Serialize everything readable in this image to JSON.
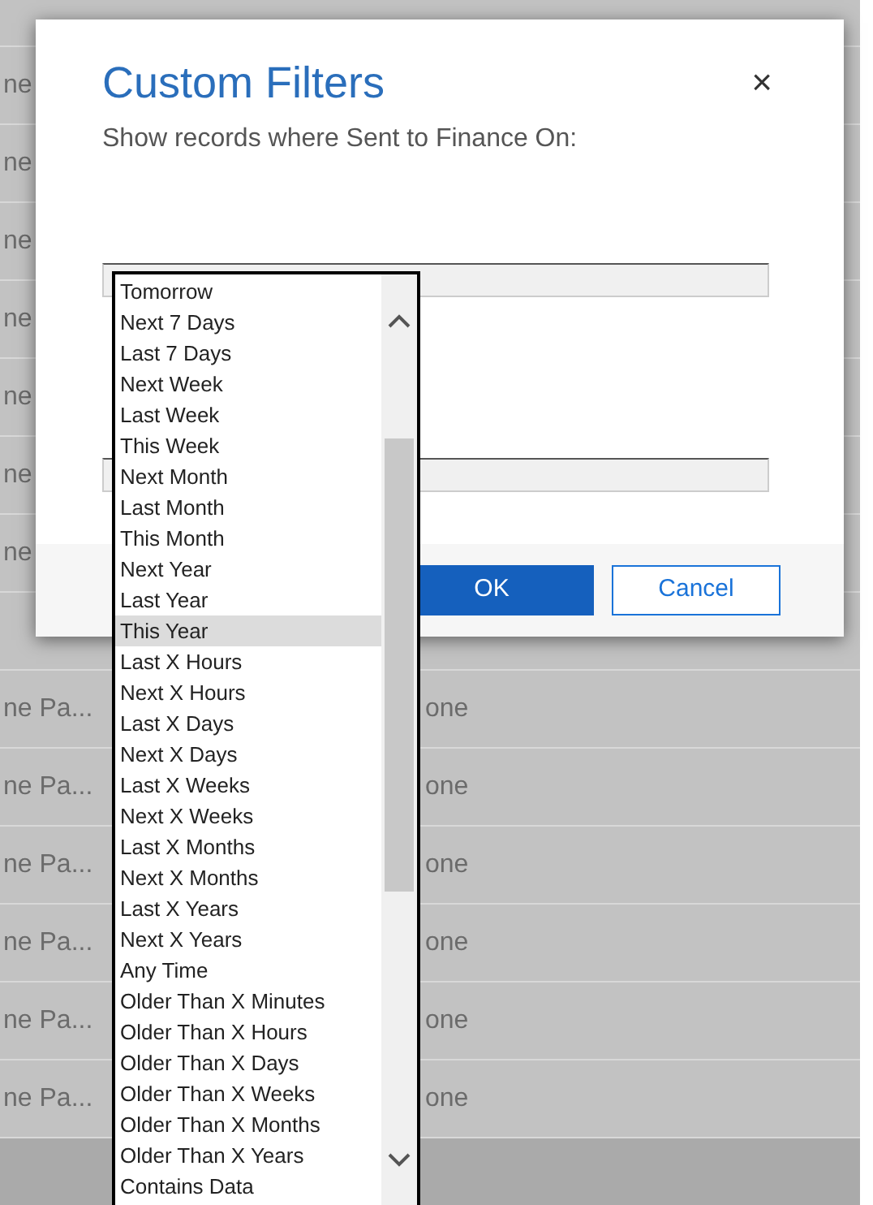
{
  "background": {
    "upper_rows": [
      {
        "column_1": "ne"
      },
      {
        "column_1": "ne"
      },
      {
        "column_1": "ne"
      },
      {
        "column_1": "ne"
      },
      {
        "column_1": "ne"
      },
      {
        "column_1": "ne"
      },
      {
        "column_1": "ne"
      }
    ],
    "lower_rows": [
      {
        "column_1": "ne Pa...",
        "column_3": "one"
      },
      {
        "column_1": "ne Pa...",
        "column_3": "one"
      },
      {
        "column_1": "ne Pa...",
        "column_3": "one"
      },
      {
        "column_1": "ne Pa...",
        "column_3": "one"
      },
      {
        "column_1": "ne Pa...",
        "column_3": "one"
      },
      {
        "column_1": "ne Pa...",
        "column_3": "one"
      }
    ]
  },
  "dialog": {
    "title": "Custom Filters",
    "close": "×",
    "subtitle": "Show records where Sent to Finance On:",
    "buttons": [
      {
        "label": "OK",
        "kind": "primary"
      },
      {
        "label": "Cancel",
        "kind": "secondary"
      }
    ]
  },
  "dropdown": {
    "items": [
      {
        "label": "Tomorrow",
        "selected": false
      },
      {
        "label": "Next 7 Days",
        "selected": false
      },
      {
        "label": "Last 7 Days",
        "selected": false
      },
      {
        "label": "Next Week",
        "selected": false
      },
      {
        "label": "Last Week",
        "selected": false
      },
      {
        "label": "This Week",
        "selected": false
      },
      {
        "label": "Next Month",
        "selected": false
      },
      {
        "label": "Last Month",
        "selected": false
      },
      {
        "label": "This Month",
        "selected": false
      },
      {
        "label": "Next Year",
        "selected": false
      },
      {
        "label": "Last Year",
        "selected": false
      },
      {
        "label": "This Year",
        "selected": true
      },
      {
        "label": "Last X Hours",
        "selected": false
      },
      {
        "label": "Next X Hours",
        "selected": false
      },
      {
        "label": "Last X Days",
        "selected": false
      },
      {
        "label": "Next X Days",
        "selected": false
      },
      {
        "label": "Last X Weeks",
        "selected": false
      },
      {
        "label": "Next X Weeks",
        "selected": false
      },
      {
        "label": "Last X Months",
        "selected": false
      },
      {
        "label": "Next X Months",
        "selected": false
      },
      {
        "label": "Last X Years",
        "selected": false
      },
      {
        "label": "Next X Years",
        "selected": false
      },
      {
        "label": "Any Time",
        "selected": false
      },
      {
        "label": "Older Than X Minutes",
        "selected": false
      },
      {
        "label": "Older Than X Hours",
        "selected": false
      },
      {
        "label": "Older Than X Days",
        "selected": false
      },
      {
        "label": "Older Than X Weeks",
        "selected": false
      },
      {
        "label": "Older Than X Months",
        "selected": false
      },
      {
        "label": "Older Than X Years",
        "selected": false
      },
      {
        "label": "Contains Data",
        "selected": false
      }
    ]
  }
}
